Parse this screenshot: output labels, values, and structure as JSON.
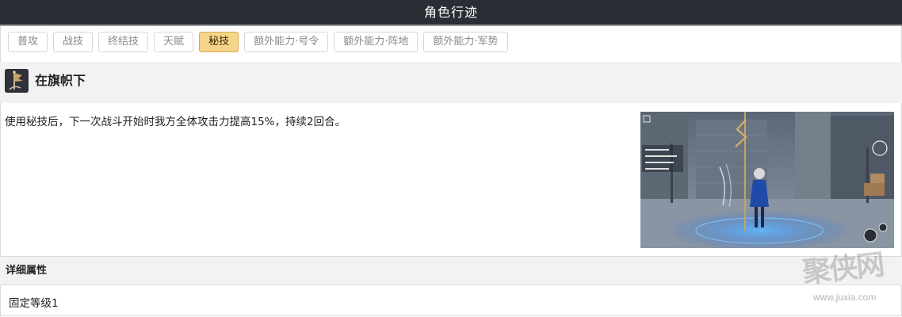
{
  "window": {
    "title": "角色行迹"
  },
  "tabs": [
    {
      "label": "普攻",
      "active": false
    },
    {
      "label": "战技",
      "active": false
    },
    {
      "label": "终结技",
      "active": false
    },
    {
      "label": "天赋",
      "active": false
    },
    {
      "label": "秘技",
      "active": true
    },
    {
      "label": "额外能力·号令",
      "active": false
    },
    {
      "label": "额外能力·阵地",
      "active": false
    },
    {
      "label": "额外能力·军势",
      "active": false
    }
  ],
  "skill": {
    "icon": "flag-skill-icon",
    "name": "在旗帜下",
    "description": "使用秘技后，下一次战斗开始时我方全体攻击力提高15%，持续2回合。",
    "preview": "gameplay-screenshot"
  },
  "details": {
    "title": "详细属性",
    "value": "固定等级1"
  },
  "watermark": {
    "logo": "聚侠网",
    "url": "www.juxia.com"
  },
  "colors": {
    "title_bar": "#2a2d33",
    "active_tab_bg": "#f6d48a",
    "active_tab_border": "#d7a94d",
    "section_bg": "#f2f2f2"
  }
}
